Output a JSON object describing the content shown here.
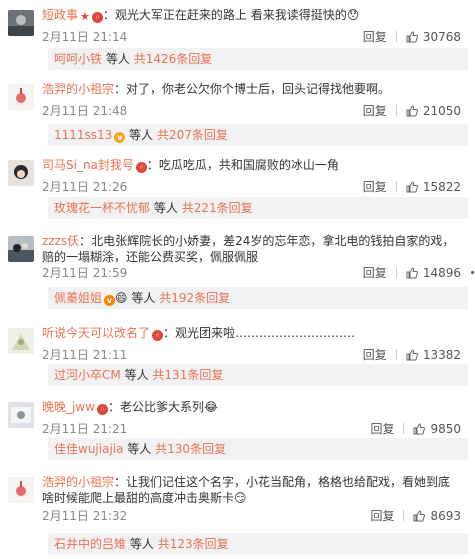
{
  "ui": {
    "reply_label": "回复",
    "etc_label": "等人",
    "total_prefix": "共",
    "reply_suffix": "条回复"
  },
  "comments": [
    {
      "user": "短政事",
      "text": "：观光大军正在赶来的路上 看来我读得挺快的",
      "date": "2月11日 21:14",
      "likes": "30768",
      "reply_user": "呵呵小铁",
      "reply_count": "1426"
    },
    {
      "user": "浩羿的小祖宗",
      "text": "：对了，你老公欠你个博士后，回头记得找他要啊。",
      "date": "2月11日 21:48",
      "likes": "21050",
      "reply_user": "1111ss13",
      "reply_count": "207"
    },
    {
      "user": "司马Si_na封我号",
      "text": "：吃瓜吃瓜，共和国腐败的冰山一角",
      "date": "2月11日 21:26",
      "likes": "15822",
      "reply_user": "玫瑰花一杯不忧郁",
      "reply_count": "221"
    },
    {
      "user": "zzzs仸",
      "text": "：北电张辉院长的小娇妻，差24岁的忘年恋，拿北电的钱拍自家的戏，",
      "text2": "赔的一塌糊涂，还能公费买奖，佩服佩服",
      "date": "2月11日 21:59",
      "likes": "14896",
      "reply_user": "佩蓁姐姐",
      "reply_count": "192"
    },
    {
      "user": "听说今天可以改名了",
      "text": "：观光团来啦…………………………",
      "date": "2月11日 21:11",
      "likes": "13382",
      "reply_user": "过河小卒CM",
      "reply_count": "131"
    },
    {
      "user": "晚晚_jww",
      "text": "：老公比爹大系列",
      "date": "2月11日 21:21",
      "likes": "9850",
      "reply_user": "佳佳wujiajia",
      "reply_count": "130"
    },
    {
      "user": "浩羿的小祖宗",
      "text": "：让我们记住这个名字，小花当配角，格格也给配戏，看她到底",
      "text2": "啥时候能爬上最甜的高度冲击奥斯卡",
      "date": "2月11日 21:32",
      "likes": "8693",
      "reply_user": "石井中的吕雉",
      "reply_count": "123"
    }
  ]
}
